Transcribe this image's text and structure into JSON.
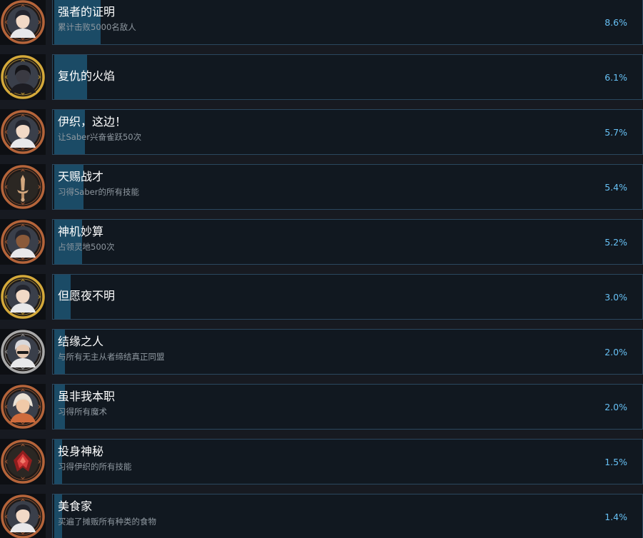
{
  "achievements": [
    {
      "title": "强者的证明",
      "description": "累计击败5000名敌人",
      "percent_label": "8.6%",
      "percent": 8.6,
      "frame": "bronze",
      "art": "portrait-dark-hair-icon"
    },
    {
      "title": "复仇的火焰",
      "description": "",
      "percent_label": "6.1%",
      "percent": 6.1,
      "frame": "gold",
      "art": "portrait-dark-figure-icon"
    },
    {
      "title": "伊织，这边！",
      "description": "让Saber兴奋雀跃50次",
      "percent_label": "5.7%",
      "percent": 5.7,
      "frame": "bronze",
      "art": "portrait-dark-hair-icon"
    },
    {
      "title": "天赐战才",
      "description": "习得Saber的所有技能",
      "percent_label": "5.4%",
      "percent": 5.4,
      "frame": "bronze",
      "art": "sword-emblem-icon"
    },
    {
      "title": "神机妙算",
      "description": "占领灵地500次",
      "percent_label": "5.2%",
      "percent": 5.2,
      "frame": "bronze",
      "art": "portrait-dark-skin-icon"
    },
    {
      "title": "但愿夜不明",
      "description": "",
      "percent_label": "3.0%",
      "percent": 3.0,
      "frame": "gold",
      "art": "portrait-dark-hair-icon"
    },
    {
      "title": "结缘之人",
      "description": "与所有无主从者缔结真正同盟",
      "percent_label": "2.0%",
      "percent": 2.0,
      "frame": "silver",
      "art": "portrait-white-hair-icon"
    },
    {
      "title": "虽非我本职",
      "description": "习得所有魔术",
      "percent_label": "2.0%",
      "percent": 2.0,
      "frame": "bronze",
      "art": "portrait-hooded-icon"
    },
    {
      "title": "投身神秘",
      "description": "习得伊织的所有技能",
      "percent_label": "1.5%",
      "percent": 1.5,
      "frame": "bronze",
      "art": "red-crest-emblem-icon"
    },
    {
      "title": "美食家",
      "description": "买遍了摊贩所有种类的食物",
      "percent_label": "1.4%",
      "percent": 1.4,
      "frame": "bronze",
      "art": "portrait-dark-hair-icon"
    }
  ],
  "colors": {
    "bronze": "#b5643a",
    "gold": "#d4a93a",
    "silver": "#a9a9a9",
    "fill": "#1b4b66",
    "percent": "#67c1f5"
  }
}
